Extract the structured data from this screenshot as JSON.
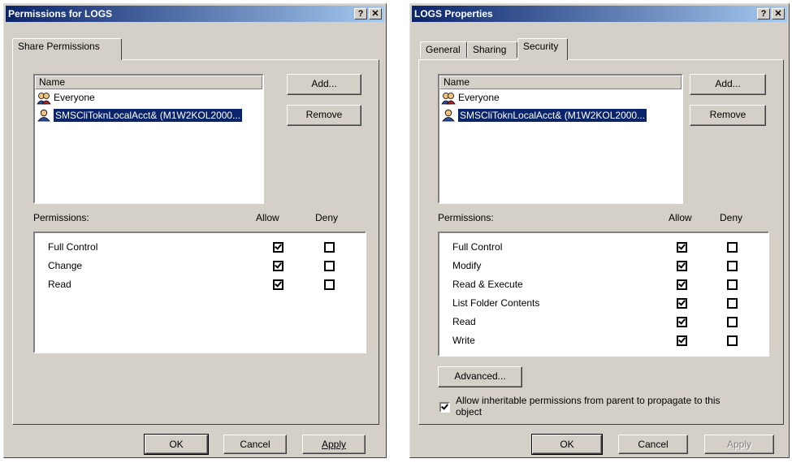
{
  "left_dialog": {
    "title": "Permissions for LOGS",
    "tabs": [
      {
        "label": "Share Permissions",
        "active": true
      }
    ],
    "users_column": "Name",
    "users": [
      {
        "name": "Everyone",
        "icon": "group-icon",
        "selected": false
      },
      {
        "name": "SMSCliToknLocalAcct& (M1W2KOL2000...",
        "icon": "user-icon",
        "selected": true
      }
    ],
    "add_label": "Add...",
    "remove_label": "Remove",
    "permissions_label": "Permissions:",
    "allow_label": "Allow",
    "deny_label": "Deny",
    "permissions": [
      {
        "name": "Full Control",
        "allow": true,
        "deny": false
      },
      {
        "name": "Change",
        "allow": true,
        "deny": false
      },
      {
        "name": "Read",
        "allow": true,
        "deny": false
      }
    ],
    "ok_label": "OK",
    "cancel_label": "Cancel",
    "apply_label": "Apply"
  },
  "right_dialog": {
    "title": "LOGS Properties",
    "tabs": [
      {
        "label": "General",
        "active": false
      },
      {
        "label": "Sharing",
        "active": false
      },
      {
        "label": "Security",
        "active": true
      }
    ],
    "users_column": "Name",
    "users": [
      {
        "name": "Everyone",
        "icon": "group-icon",
        "selected": false
      },
      {
        "name": "SMSCliToknLocalAcct& (M1W2KOL2000...",
        "icon": "user-icon",
        "selected": true
      }
    ],
    "add_label": "Add...",
    "remove_label": "Remove",
    "permissions_label": "Permissions:",
    "allow_label": "Allow",
    "deny_label": "Deny",
    "permissions": [
      {
        "name": "Full Control",
        "allow": true,
        "deny": false
      },
      {
        "name": "Modify",
        "allow": true,
        "deny": false
      },
      {
        "name": "Read & Execute",
        "allow": true,
        "deny": false
      },
      {
        "name": "List Folder Contents",
        "allow": true,
        "deny": false
      },
      {
        "name": "Read",
        "allow": true,
        "deny": false
      },
      {
        "name": "Write",
        "allow": true,
        "deny": false
      }
    ],
    "advanced_label": "Advanced...",
    "inherit_label": "Allow inheritable permissions from parent to propagate to this object",
    "inherit_checked": true,
    "ok_label": "OK",
    "cancel_label": "Cancel",
    "apply_label": "Apply",
    "apply_disabled": true
  },
  "colors": {
    "title_start": "#0a246a",
    "title_end": "#a6caf0",
    "face": "#d4d0c8",
    "selection": "#0a246a"
  }
}
